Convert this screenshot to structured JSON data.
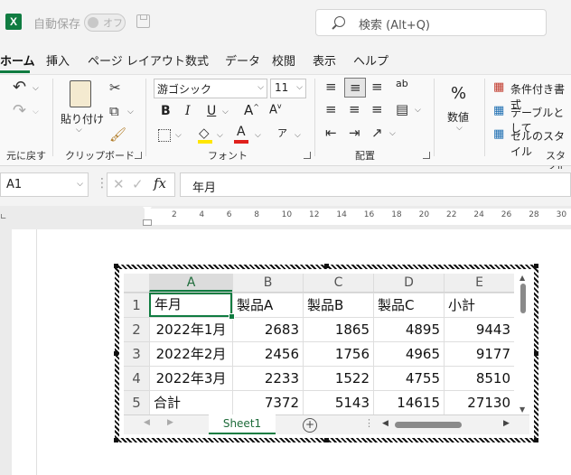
{
  "titlebar": {
    "app_logo": "X",
    "autosave_label": "自動保存",
    "autosave_state": "オフ",
    "save_icon": "save-icon",
    "search_placeholder": "検索 (Alt+Q)"
  },
  "menu": [
    "ホーム",
    "挿入",
    "ページ レイアウト",
    "数式",
    "データ",
    "校閲",
    "表示",
    "ヘルプ"
  ],
  "ribbon": {
    "groups": {
      "undo": "元に戻す",
      "clipboard": "クリップボード",
      "font": "フォント",
      "alignment": "配置"
    },
    "paste_label": "貼り付け",
    "font_name": "游ゴシック",
    "font_size": "11",
    "bold": "B",
    "italic": "I",
    "underline": "U",
    "number_icon": "%",
    "number_label": "数値",
    "styles": [
      "条件付き書式",
      "テーブルとして",
      "セルのスタイル"
    ],
    "styles_group": "スタイル"
  },
  "formula_bar": {
    "name_box": "A1",
    "fx": "fx",
    "content": "年月"
  },
  "ruler_numbers": [
    "2",
    "4",
    "6",
    "8",
    "10",
    "12",
    "14",
    "16",
    "18",
    "20",
    "22",
    "24",
    "26",
    "28",
    "30"
  ],
  "sheet": {
    "columns": [
      "A",
      "B",
      "C",
      "D",
      "E"
    ],
    "rows": [
      {
        "num": "1",
        "cells": [
          "年月",
          "製品A",
          "製品B",
          "製品C",
          "小計"
        ]
      },
      {
        "num": "2",
        "cells": [
          "2022年1月",
          "2683",
          "1865",
          "4895",
          "9443"
        ]
      },
      {
        "num": "3",
        "cells": [
          "2022年2月",
          "2456",
          "1756",
          "4965",
          "9177"
        ]
      },
      {
        "num": "4",
        "cells": [
          "2022年3月",
          "2233",
          "1522",
          "4755",
          "8510"
        ]
      },
      {
        "num": "5",
        "cells": [
          "合計",
          "7372",
          "5143",
          "14615",
          "27130"
        ]
      }
    ],
    "tab_name": "Sheet1",
    "add_sheet": "+"
  },
  "colors": {
    "accent": "#107c41"
  }
}
